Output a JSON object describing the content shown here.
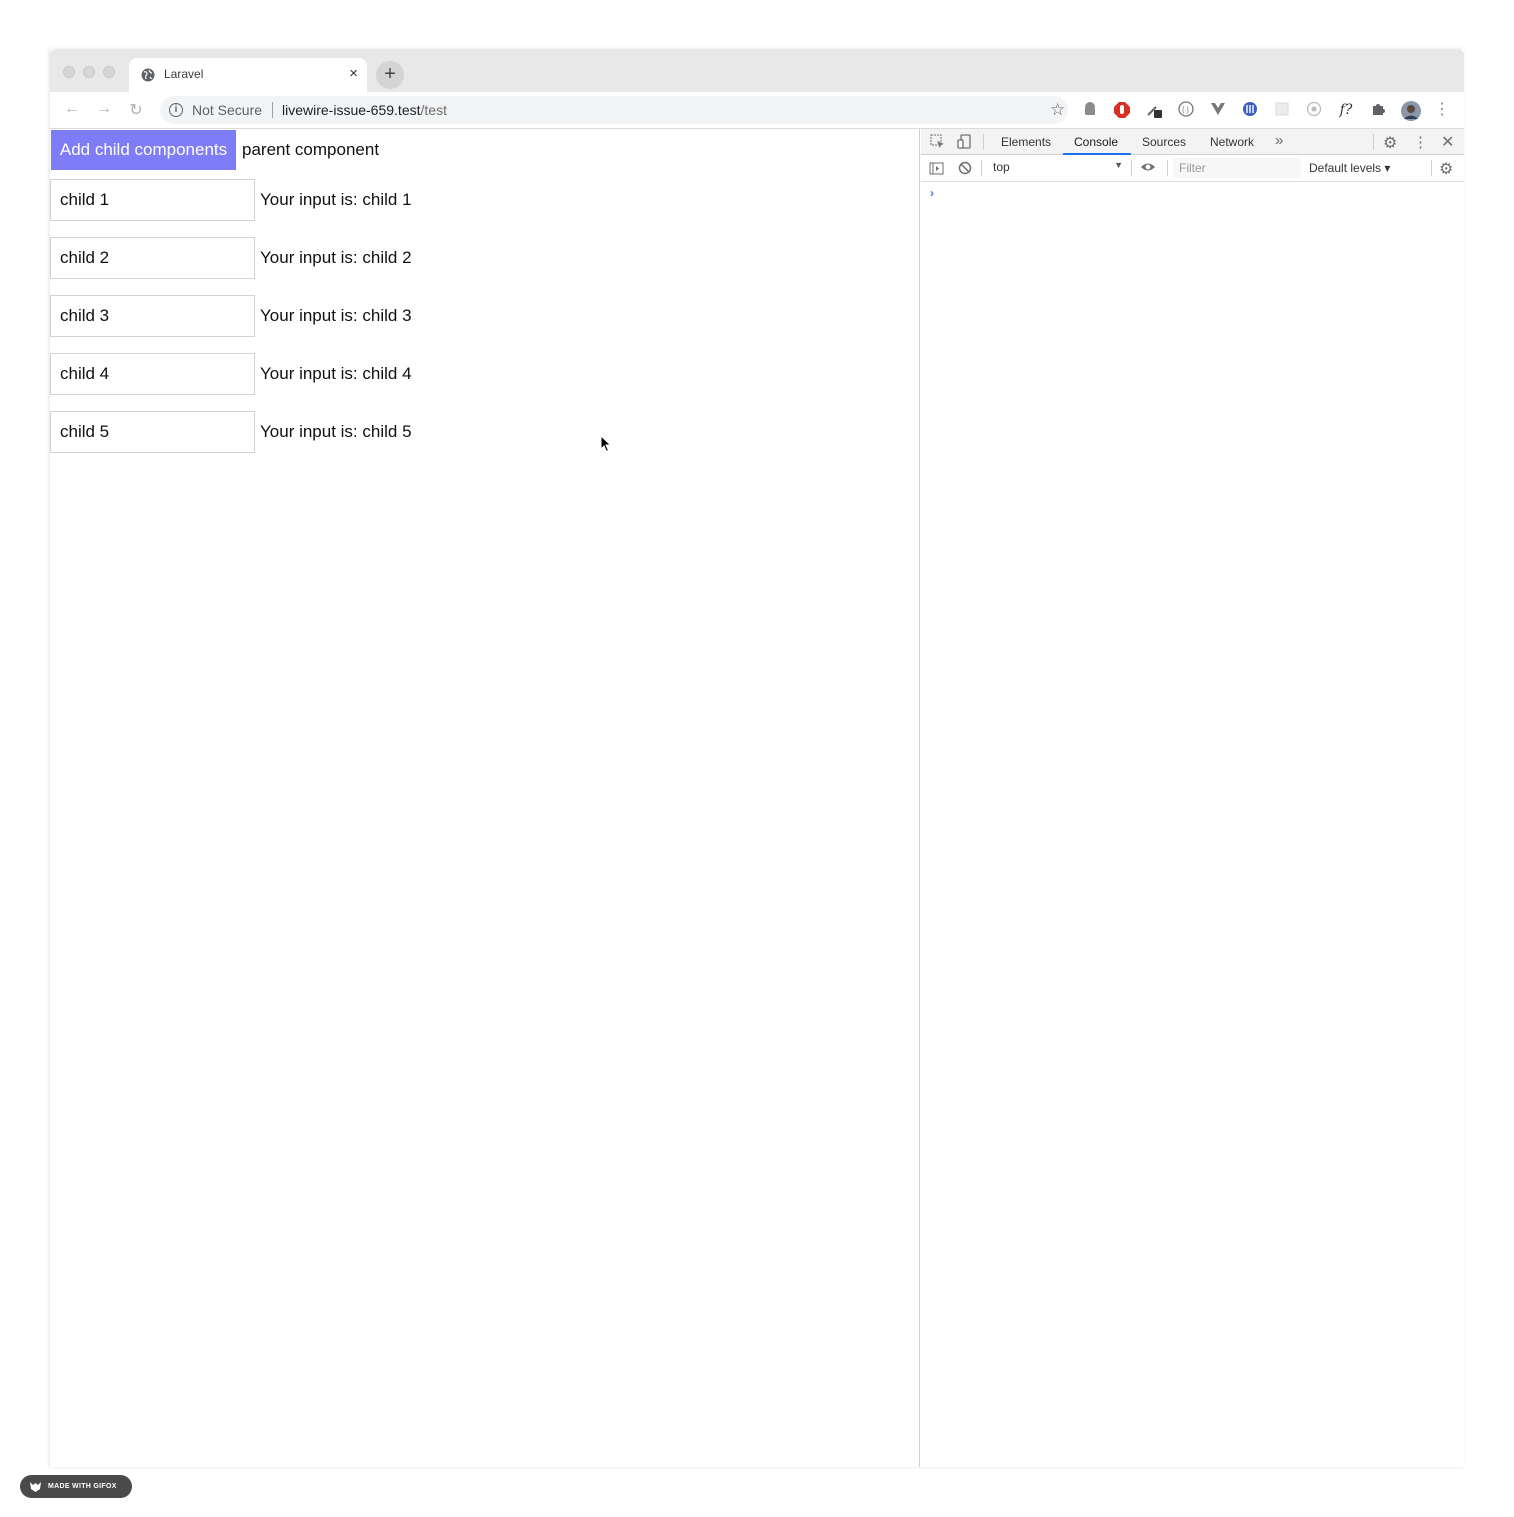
{
  "browser": {
    "tab_title": "Laravel",
    "tab_close": "×",
    "new_tab": "+",
    "security_label": "Not Secure",
    "url_host": "livewire-issue-659.test",
    "url_path": "/test",
    "nav": {
      "back": "←",
      "forward": "→",
      "reload": "↻"
    },
    "extensions": [
      "android-icon",
      "adblock-icon",
      "eyedropper-icon",
      "json-viewer-icon",
      "vue-devtools-icon",
      "wappalyzer-icon",
      "blank-extension-icon",
      "color-picker-icon",
      "fontface-ninja-icon",
      "puzzle-icon",
      "profile-avatar",
      "more-menu-icon"
    ],
    "ext_glyphs": {
      "fontface": "f?",
      "more": "⋮"
    }
  },
  "page": {
    "add_button_label": "Add child components",
    "parent_label": "parent component",
    "children": [
      {
        "value": "child 1",
        "output": "Your input is: child 1"
      },
      {
        "value": "child 2",
        "output": "Your input is: child 2"
      },
      {
        "value": "child 3",
        "output": "Your input is: child 3"
      },
      {
        "value": "child 4",
        "output": "Your input is: child 4"
      },
      {
        "value": "child 5",
        "output": "Your input is: child 5"
      }
    ]
  },
  "devtools": {
    "tabs": [
      "Elements",
      "Console",
      "Sources",
      "Network"
    ],
    "active_tab": "Console",
    "more_tabs": "»",
    "context": "top",
    "filter_placeholder": "Filter",
    "levels": "Default levels ▾",
    "prompt": "›",
    "accent": "#1a73e8"
  },
  "watermark": {
    "text": "MADE WITH GIFOX"
  },
  "colors": {
    "button": "#7f7cf8",
    "button_text": "#ffffff"
  }
}
